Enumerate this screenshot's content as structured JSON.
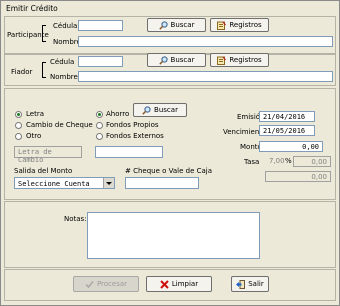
{
  "window": {
    "title": "Emitir Crédito"
  },
  "participante": {
    "label": "Participante",
    "cedula_label": "Cédula",
    "nombre_label": "Nombre",
    "buscar_label": "Buscar",
    "registros_label": "Registros"
  },
  "fiador": {
    "label": "Fiador",
    "cedula_label": "Cédula",
    "nombre_label": "Nombre",
    "buscar_label": "Buscar",
    "registros_label": "Registros"
  },
  "tipo": {
    "options": [
      {
        "label": "Letra",
        "selected": true
      },
      {
        "label": "Cambio de Cheque",
        "selected": false
      },
      {
        "label": "Otro",
        "selected": false
      }
    ],
    "letra_placeholder": "Letra de Cambio"
  },
  "origen": {
    "options": [
      {
        "label": "Ahorro",
        "selected": true
      },
      {
        "label": "Fondos Propios",
        "selected": false
      },
      {
        "label": "Fondos Externos",
        "selected": false
      }
    ],
    "buscar_label": "Buscar"
  },
  "fechas": {
    "emision_label": "Emisión",
    "emision_value": "21/04/2016",
    "vencimiento_label": "Vencimiento",
    "vencimiento_value": "21/05/2016"
  },
  "monto": {
    "label": "Monto",
    "value": "0,00"
  },
  "tasa": {
    "label": "Tasa",
    "rate": "7,00",
    "percent_sign": "%",
    "value1": "0,00",
    "value2": "0,00"
  },
  "salida": {
    "label": "Salida del Monto",
    "selected": "Seleccione Cuenta"
  },
  "cheque": {
    "label": "# Cheque o  Vale de Caja"
  },
  "notas": {
    "label": "Notas:"
  },
  "footer": {
    "procesar_label": "Procesar",
    "limpiar_label": "Limpiar",
    "salir_label": "Salir"
  }
}
